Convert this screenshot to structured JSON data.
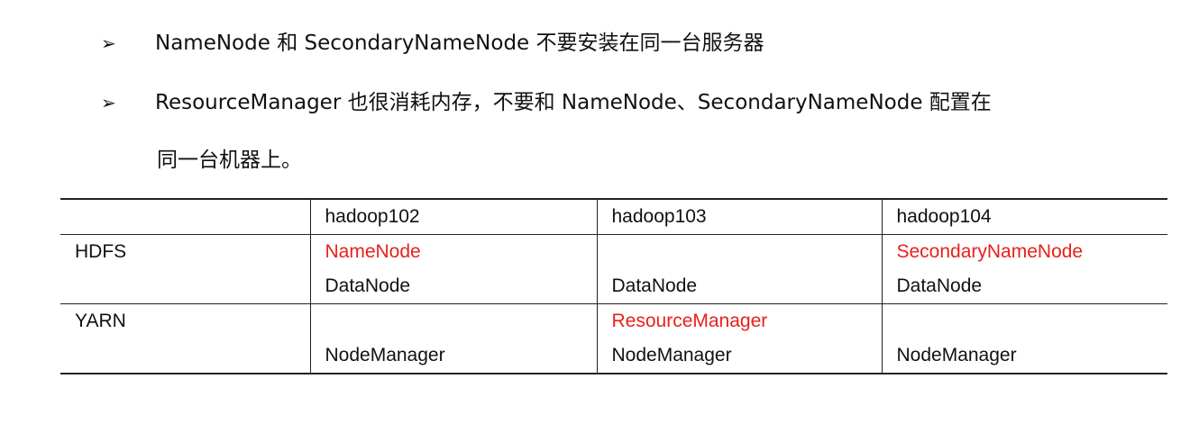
{
  "bullets": [
    {
      "icon": "➢",
      "text": "NameNode 和 SecondaryNameNode 不要安装在同一台服务器"
    },
    {
      "icon": "➢",
      "text": "ResourceManager 也很消耗内存，不要和 NameNode、SecondaryNameNode 配置在",
      "continuation": "同一台机器上。"
    }
  ],
  "table": {
    "headers": [
      "",
      "hadoop102",
      "hadoop103",
      "hadoop104"
    ],
    "rows": [
      {
        "label": "HDFS",
        "cells": [
          [
            "NameNode",
            "DataNode"
          ],
          [
            "",
            "DataNode"
          ],
          [
            "SecondaryNameNode",
            "DataNode"
          ]
        ]
      },
      {
        "label": "YARN",
        "cells": [
          [
            "",
            "NodeManager"
          ],
          [
            "ResourceManager",
            "NodeManager"
          ],
          [
            "",
            "NodeManager"
          ]
        ]
      }
    ]
  },
  "colors": {
    "highlight": "#e8201a",
    "text": "#111111"
  }
}
